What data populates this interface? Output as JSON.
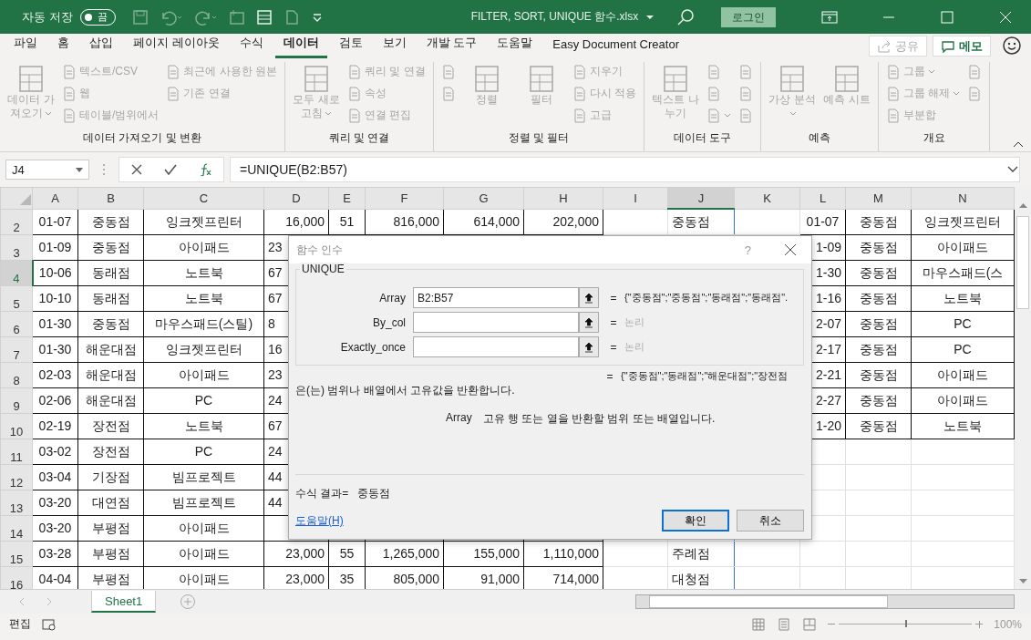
{
  "title_bar": {
    "autosave_label": "자동 저장",
    "autosave": {
      "label": "끔",
      "on": false
    },
    "file_name": "FILTER, SORT, UNIQUE 함수.xlsx",
    "login": "로그인"
  },
  "tabs": [
    {
      "label": "파일",
      "selected": false
    },
    {
      "label": "홈",
      "selected": false
    },
    {
      "label": "삽입",
      "selected": false
    },
    {
      "label": "페이지 레이아웃",
      "selected": false
    },
    {
      "label": "수식",
      "selected": false
    },
    {
      "label": "데이터",
      "selected": true
    },
    {
      "label": "검토",
      "selected": false
    },
    {
      "label": "보기",
      "selected": false
    },
    {
      "label": "개발 도구",
      "selected": false
    },
    {
      "label": "도움말",
      "selected": false
    },
    {
      "label": "Easy Document Creator",
      "selected": false
    }
  ],
  "share": {
    "label": "공유",
    "disabled": true
  },
  "memo": {
    "label": "메모",
    "disabled": false
  },
  "ribbon": [
    {
      "label": "데이터 가져오기 및 변환",
      "columns": [
        {
          "kind": "large",
          "label": "데이터 가져오기",
          "dropdown": true,
          "disabled": true
        },
        {
          "kind": "stack",
          "items": [
            {
              "label": "텍스트/CSV",
              "disabled": true
            },
            {
              "label": "웹",
              "disabled": true
            },
            {
              "label": "테이블/범위에서",
              "disabled": true
            }
          ]
        },
        {
          "kind": "stack",
          "items": [
            {
              "label": "최근에 사용한 원본",
              "disabled": true
            },
            {
              "label": "기존 연결",
              "disabled": true
            }
          ]
        }
      ]
    },
    {
      "label": "쿼리 및 연결",
      "columns": [
        {
          "kind": "large",
          "label": "모두 새로 고침",
          "dropdown": true,
          "disabled": true
        },
        {
          "kind": "stack",
          "items": [
            {
              "label": "쿼리 및 연결",
              "disabled": true
            },
            {
              "label": "속성",
              "disabled": true
            },
            {
              "label": "연결 편집",
              "disabled": true
            }
          ]
        }
      ]
    },
    {
      "label": "정렬 및 필터",
      "columns": [
        {
          "kind": "stack",
          "items": [
            {
              "disabled": true
            },
            {
              "disabled": true
            }
          ]
        },
        {
          "kind": "large",
          "label": "정렬",
          "disabled": true
        },
        {
          "kind": "large",
          "label": "필터",
          "disabled": true
        },
        {
          "kind": "stack",
          "items": [
            {
              "label": "지우기",
              "disabled": true
            },
            {
              "label": "다시 적용",
              "disabled": true
            },
            {
              "label": "고급",
              "disabled": true
            }
          ]
        }
      ]
    },
    {
      "label": "데이터 도구",
      "columns": [
        {
          "kind": "large",
          "label": "텍스트 나누기",
          "disabled": true
        },
        {
          "kind": "stack",
          "items": [
            {
              "disabled": true
            },
            {
              "disabled": true
            },
            {
              "disabled": true,
              "dropdown": true
            }
          ]
        },
        {
          "kind": "stack",
          "items": [
            {
              "disabled": true
            },
            {
              "disabled": true
            },
            {
              "disabled": true
            }
          ]
        }
      ]
    },
    {
      "label": "예측",
      "columns": [
        {
          "kind": "large",
          "label": "가상 분석",
          "dropdown": true,
          "disabled": true
        },
        {
          "kind": "large",
          "label": "예측 시트",
          "disabled": true
        }
      ]
    },
    {
      "label": "개요",
      "columns": [
        {
          "kind": "stack",
          "items": [
            {
              "label": "그룹",
              "dropdown": true,
              "disabled": true
            },
            {
              "label": "그룹 해제",
              "dropdown": true,
              "disabled": true
            },
            {
              "label": "부분합",
              "disabled": true
            }
          ]
        },
        {
          "kind": "stack",
          "items": [
            {
              "disabled": true
            },
            {
              "disabled": true
            }
          ]
        }
      ]
    }
  ],
  "formula_bar": {
    "name_box": "J4",
    "formula": "=UNIQUE(B2:B57)"
  },
  "columns": [
    {
      "label": "A",
      "selected": false
    },
    {
      "label": "B",
      "selected": false
    },
    {
      "label": "C",
      "selected": false
    },
    {
      "label": "D",
      "selected": false
    },
    {
      "label": "E",
      "selected": false
    },
    {
      "label": "F",
      "selected": false
    },
    {
      "label": "G",
      "selected": false
    },
    {
      "label": "H",
      "selected": false
    },
    {
      "label": "I",
      "selected": false
    },
    {
      "label": "J",
      "selected": true
    },
    {
      "label": "K",
      "selected": false
    },
    {
      "label": "L",
      "selected": false
    },
    {
      "label": "M",
      "selected": false
    },
    {
      "label": "N",
      "selected": false
    }
  ],
  "rows": [
    {
      "number": "2",
      "selected": false,
      "cells": [
        "01-07",
        "중동점",
        "잉크젯프린터",
        "16,000",
        "51",
        "816,000",
        "614,000",
        "202,000",
        null,
        "중동점",
        null,
        "01-07",
        "중동점",
        "잉크젯프린터"
      ]
    },
    {
      "number": "3",
      "selected": false,
      "cells": [
        "01-09",
        "중동점",
        "아이패드",
        "23",
        null,
        null,
        null,
        null,
        null,
        null,
        null,
        "1-09",
        "중동점",
        "아이패드"
      ]
    },
    {
      "number": "4",
      "selected": true,
      "cells": [
        "10-06",
        "동래점",
        "노트북",
        "67",
        null,
        null,
        null,
        null,
        null,
        null,
        null,
        "1-30",
        "중동점",
        "마우스패드(스"
      ]
    },
    {
      "number": "5",
      "selected": false,
      "cells": [
        "10-10",
        "동래점",
        "노트북",
        "67",
        null,
        null,
        null,
        null,
        null,
        null,
        null,
        "1-16",
        "중동점",
        "노트북"
      ]
    },
    {
      "number": "6",
      "selected": false,
      "cells": [
        "01-30",
        "중동점",
        "마우스패드(스틸)",
        "8",
        null,
        null,
        null,
        null,
        null,
        null,
        null,
        "2-07",
        "중동점",
        "PC"
      ]
    },
    {
      "number": "7",
      "selected": false,
      "cells": [
        "01-30",
        "해운대점",
        "잉크젯프린터",
        "16",
        null,
        null,
        null,
        null,
        null,
        null,
        null,
        "2-17",
        "중동점",
        "PC"
      ]
    },
    {
      "number": "8",
      "selected": false,
      "cells": [
        "02-03",
        "해운대점",
        "아이패드",
        "23",
        null,
        null,
        null,
        null,
        null,
        null,
        null,
        "2-21",
        "중동점",
        "아이패드"
      ]
    },
    {
      "number": "9",
      "selected": false,
      "cells": [
        "02-06",
        "해운대점",
        "PC",
        "24",
        null,
        null,
        null,
        null,
        null,
        null,
        null,
        "2-27",
        "중동점",
        "아이패드"
      ]
    },
    {
      "number": "10",
      "selected": false,
      "cells": [
        "02-19",
        "장전점",
        "노트북",
        "67",
        null,
        null,
        null,
        null,
        null,
        null,
        null,
        "1-20",
        "중동점",
        "노트북"
      ]
    },
    {
      "number": "11",
      "selected": false,
      "cells": [
        "03-02",
        "장전점",
        "PC",
        "24",
        null,
        null,
        null,
        null,
        null,
        null,
        null,
        null,
        null,
        null
      ]
    },
    {
      "number": "12",
      "selected": false,
      "cells": [
        "03-04",
        "기장점",
        "빔프로젝트",
        "44",
        null,
        null,
        null,
        null,
        null,
        null,
        null,
        null,
        null,
        null
      ]
    },
    {
      "number": "13",
      "selected": false,
      "cells": [
        "03-20",
        "대연점",
        "빔프로젝트",
        "44",
        null,
        null,
        null,
        null,
        null,
        null,
        null,
        null,
        null,
        null
      ]
    },
    {
      "number": "14",
      "selected": false,
      "cells": [
        "03-20",
        "부평점",
        "아이패드",
        null,
        null,
        null,
        null,
        null,
        null,
        null,
        null,
        null,
        null,
        null
      ]
    },
    {
      "number": "15",
      "selected": false,
      "cells": [
        "03-28",
        "부평점",
        "아이패드",
        "23,000",
        "55",
        "1,265,000",
        "155,000",
        "1,110,000",
        null,
        "주례점",
        null,
        null,
        null,
        null
      ]
    },
    {
      "number": "16",
      "selected": false,
      "cells": [
        "04-04",
        "부평점",
        "아이패드",
        "23,000",
        "35",
        "805,000",
        "91,000",
        "714,000",
        null,
        "대청점",
        null,
        null,
        null,
        null
      ]
    }
  ],
  "dialog": {
    "title": "함수 인수",
    "help_mark": "?",
    "function_name": "UNIQUE",
    "args": [
      {
        "name": "Array",
        "value": "B2:B57",
        "eq": "=",
        "result": "{\"중동점\";\"중동점\";\"동래점\";\"동래점\".",
        "dimmed": false
      },
      {
        "name": "By_col",
        "eq": "=",
        "result": "논리",
        "dimmed": true
      },
      {
        "name": "Exactly_once",
        "eq": "=",
        "result": "논리",
        "dimmed": true
      }
    ],
    "total_eq": "=",
    "total": "{\"중동점\";\"동래점\";\"해운대점\";\"장전점",
    "description": "은(는) 범위나 배열에서 고유값을 반환합니다.",
    "arg_help_name": "Array",
    "arg_help": "고유 행 또는 열을 반환할 범위 또는 배열입니다.",
    "result_label": "수식 결과=",
    "result_value": "중동점",
    "help_link": "도움말(H)",
    "buttons": [
      {
        "label": "확인",
        "selected": true
      },
      {
        "label": "취소",
        "selected": false
      }
    ]
  },
  "sheets": [
    {
      "label": "Sheet1",
      "selected": true
    }
  ],
  "status": {
    "mode": "편집",
    "zoom": "100%",
    "level": 0.5
  }
}
